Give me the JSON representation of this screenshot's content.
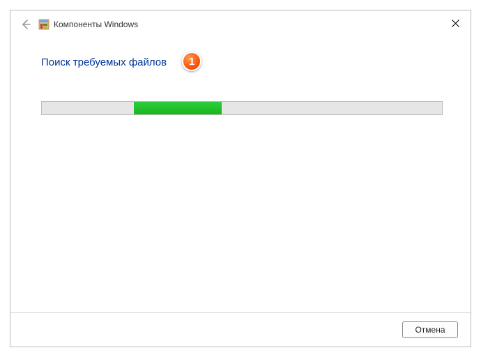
{
  "header": {
    "title": "Компоненты Windows"
  },
  "content": {
    "status_text": "Поиск требуемых файлов",
    "callout_number": "1",
    "progress": {
      "indeterminate": true,
      "chunk_left_pct": 23,
      "chunk_width_pct": 22
    }
  },
  "footer": {
    "cancel_label": "Отмена"
  }
}
